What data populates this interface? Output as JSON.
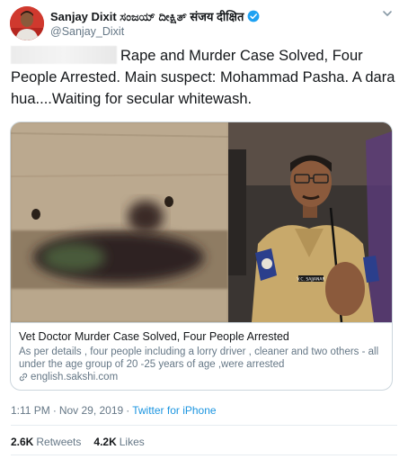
{
  "author": {
    "name": "Sanjay Dixit ಸಂಜಯ್ ದೀಕ್ಷಿತ್ संजय दीक्षित",
    "handle": "@Sanjay_Dixit",
    "verified": true,
    "avatar_icon": "profile-photo"
  },
  "tweet": {
    "text": "Rape and Murder Case Solved, Four People Arrested. Main suspect: Mohammad Pasha. A dara hua....Waiting for secular whitewash."
  },
  "card": {
    "title": "Vet Doctor Murder Case Solved, Four People Arrested",
    "description": "As per details , four people including a lorry driver , cleaner and two others - all under the age group of 20 -25 years of age ,were arrested",
    "domain": "english.sakshi.com",
    "image_name_tag": "V.C. SAJJANAR"
  },
  "meta": {
    "time": "1:11 PM",
    "separator": "·",
    "date": "Nov 29, 2019",
    "source": "Twitter for iPhone"
  },
  "stats": {
    "retweets": "2.6K",
    "retweets_label": "Retweets",
    "likes": "4.2K",
    "likes_label": "Likes"
  },
  "colors": {
    "link": "#1b95e0",
    "secondary_text": "#657786",
    "border": "#ccd6dd"
  }
}
